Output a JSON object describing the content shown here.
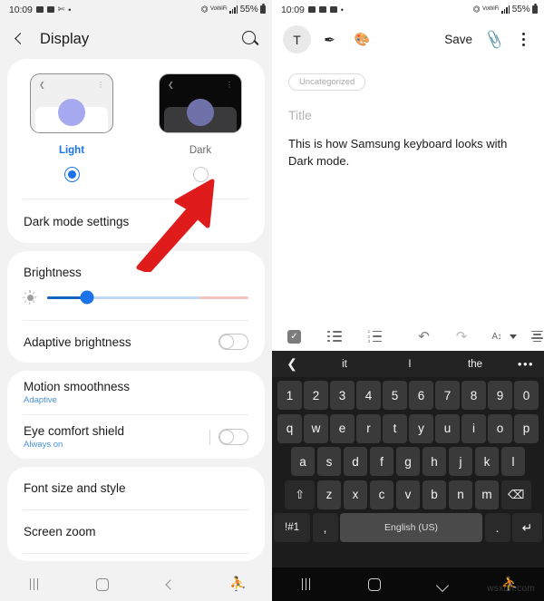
{
  "left_panel": {
    "statusbar": {
      "time": "10:09",
      "left_icons": [
        "gallery-icon",
        "message-icon",
        "scissors-icon",
        "dot-icon"
      ],
      "right_icons": [
        "wifi-icon",
        "vowifi-icon",
        "signal-icon"
      ],
      "battery": "55%"
    },
    "appbar": {
      "back": "back-chevron",
      "title": "Display",
      "search": "search-icon"
    },
    "modes": [
      {
        "label": "Light",
        "selected": true,
        "thumb": "light-preview"
      },
      {
        "label": "Dark",
        "selected": false,
        "thumb": "dark-preview"
      }
    ],
    "dark_mode_settings": {
      "title": "Dark mode settings"
    },
    "brightness": {
      "title": "Brightness",
      "icon": "brightness-sun-icon",
      "value_percent": 20
    },
    "adaptive_brightness": {
      "title": "Adaptive brightness",
      "toggle": "off"
    },
    "motion_smoothness": {
      "title": "Motion smoothness",
      "subtitle": "Adaptive"
    },
    "eye_comfort_shield": {
      "title": "Eye comfort shield",
      "subtitle": "Always on",
      "toggle": "off"
    },
    "font_size_and_style": {
      "title": "Font size and style"
    },
    "screen_zoom": {
      "title": "Screen zoom"
    },
    "annotation": {
      "type": "red-arrow",
      "points_to": "Dark mode radio button",
      "color": "#e01b1b"
    },
    "navbar": [
      "recents-icon",
      "home-icon",
      "back-icon",
      "accessibility-icon"
    ],
    "colors": {
      "accent": "#1a73e8",
      "background": "#f2f2f2",
      "card": "#ffffff",
      "sub_text": "#4a90d9"
    }
  },
  "right_panel": {
    "statusbar": {
      "time": "10:09",
      "left_icons": [
        "image-icon",
        "gallery-icon",
        "message-icon",
        "dot-icon"
      ],
      "right_icons": [
        "wifi-icon",
        "vowifi-icon",
        "signal-icon"
      ],
      "battery": "55%"
    },
    "note_toolbar": {
      "text_mode": "T",
      "pen_mode": "pen-icon",
      "palette_mode": "palette-icon",
      "save_label": "Save",
      "attach": "paperclip-icon",
      "more": "kebab-menu-icon"
    },
    "note": {
      "category_chip": "Uncategorized",
      "title_placeholder": "Title",
      "body": "This is how Samsung keyboard looks with Dark mode."
    },
    "editor_toolbar": {
      "items": [
        "checkbox-icon",
        "bulleted-list-icon",
        "numbered-list-icon",
        "undo-icon",
        "redo-icon",
        "font-size-icon",
        "caret-down-icon",
        "align-icon"
      ]
    },
    "keyboard": {
      "suggestions": [
        "it",
        "I",
        "the"
      ],
      "nav_left": "chevron-left-icon",
      "more": "more-dots-icon",
      "rows": {
        "numbers": [
          "1",
          "2",
          "3",
          "4",
          "5",
          "6",
          "7",
          "8",
          "9",
          "0"
        ],
        "top": [
          "q",
          "w",
          "e",
          "r",
          "t",
          "y",
          "u",
          "i",
          "o",
          "p"
        ],
        "home": [
          "a",
          "s",
          "d",
          "f",
          "g",
          "h",
          "j",
          "k",
          "l"
        ],
        "bottom": [
          "z",
          "x",
          "c",
          "v",
          "b",
          "n",
          "m"
        ]
      },
      "shift": "⇧",
      "backspace": "⌫",
      "symbols": "!#1",
      "comma": ",",
      "space_label": "English (US)",
      "period": ".",
      "enter": "↵",
      "theme": "dark",
      "colors": {
        "key": "#3a3a3a",
        "key_alt": "#2a2a2a",
        "space": "#4a4a4a",
        "background": "#1c1c1c"
      }
    },
    "navbar": [
      "recents-icon",
      "home-icon",
      "chevron-down-icon",
      "accessibility-icon"
    ]
  },
  "watermark": "wsxdn.com"
}
